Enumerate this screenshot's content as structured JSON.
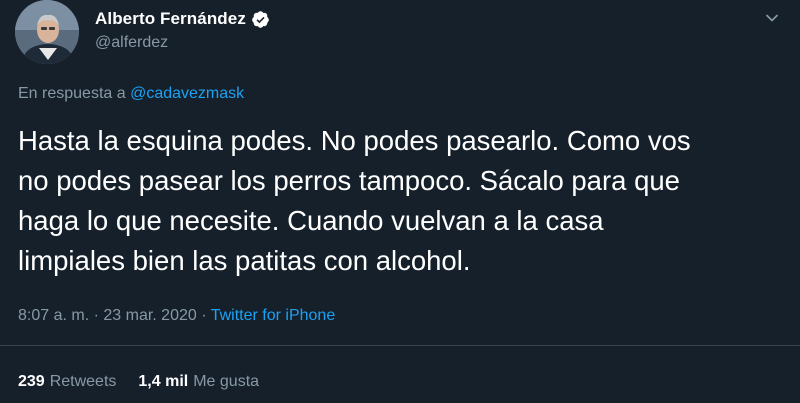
{
  "author": {
    "display_name": "Alberto Fernández",
    "handle": "@alferdez",
    "verified": true
  },
  "reply": {
    "prefix": "En respuesta a",
    "mention": "@cadavezmask"
  },
  "tweet": {
    "lines": [
      "Hasta la esquina podes. No podes pasearlo. Como vos",
      "no podes pasear los perros tampoco. Sácalo para que",
      "haga lo que necesite. Cuando vuelvan a la casa",
      "limpiales bien las patitas con alcohol."
    ]
  },
  "meta": {
    "time": "8:07 a. m.",
    "separator1": " · ",
    "date": "23 mar. 2020",
    "separator2": " · ",
    "source": "Twitter for iPhone"
  },
  "stats": {
    "retweets_count": "239",
    "retweets_label": "Retweets",
    "likes_count": "1,4 mil",
    "likes_label": "Me gusta"
  },
  "icons": {
    "verified": "verified-badge-icon",
    "menu": "chevron-down-icon"
  },
  "colors": {
    "background": "#15202b",
    "text": "#ffffff",
    "secondary": "#8899a6",
    "link": "#1da1f2",
    "divider": "#38444d"
  }
}
